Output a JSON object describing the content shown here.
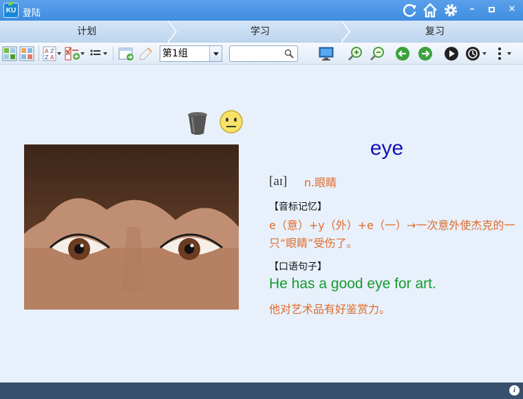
{
  "window": {
    "title": "登陆",
    "logo_text": "KU"
  },
  "tabs": [
    {
      "label": "计划"
    },
    {
      "label": "学习"
    },
    {
      "label": "复习"
    }
  ],
  "toolbar": {
    "group_select": {
      "value": "第1组"
    },
    "search": {
      "value": "",
      "placeholder": ""
    }
  },
  "card": {
    "word": "eye",
    "phonetic": "[aɪ]",
    "definition": "n.眼睛",
    "mnemonic_label": "【音标记忆】",
    "mnemonic_text": "e（意）+y（外）+e（一）→一次意外使杰克的一只“眼睛”受伤了。",
    "sentence_label": "【口语句子】",
    "sentence_en": "He has a good eye for art.",
    "sentence_cn": "他对艺术品有好鉴赏力。"
  },
  "colors": {
    "titlebar": "#4a96e6",
    "word": "#1212b8",
    "orange": "#e06a2a",
    "green": "#159a2c",
    "statusbar": "#36506e"
  },
  "icons": {
    "titlebar": [
      "refresh-icon",
      "home-icon",
      "settings-gear-icon",
      "minimize-icon",
      "maximize-icon",
      "close-icon"
    ],
    "toolbar": [
      "add-word-icon",
      "grid-view-icon",
      "sort-az-icon",
      "check-list-icon",
      "list-options-icon",
      "import-icon",
      "edit-icon",
      "display-icon",
      "zoom-in-icon",
      "zoom-out-icon",
      "previous-icon",
      "next-icon",
      "play-icon",
      "timer-icon",
      "more-icon"
    ],
    "card": [
      "trash-bin-icon",
      "smiley-icon"
    ]
  }
}
